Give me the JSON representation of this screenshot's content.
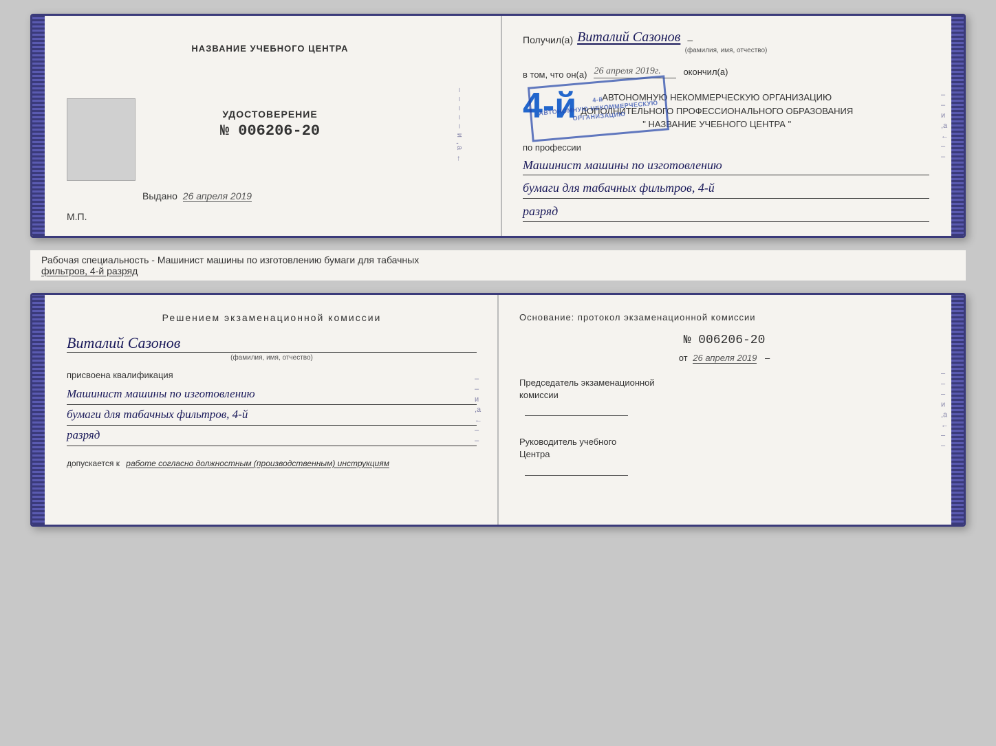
{
  "topBook": {
    "leftPage": {
      "centerTitle": "НАЗВАНИЕ УЧЕБНОГО ЦЕНТРА",
      "certLabel": "УДОСТОВЕРЕНИЕ",
      "certNumber": "№ 006206-20",
      "issuedLabel": "Выдано",
      "issuedDate": "26 апреля 2019",
      "mpLabel": "М.П."
    },
    "rightPage": {
      "recipientPrefix": "Получил(а)",
      "recipientName": "Виталий Сазонов",
      "recipientSubLabel": "(фамилия, имя, отчество)",
      "vtomLabel": "в том, что он(а)",
      "vtomDate": "26 апреля 2019г.",
      "okonchilLabel": "окончил(а)",
      "orgLine1": "АВТОНОМНУЮ НЕКОММЕРЧЕСКУЮ ОРГАНИЗАЦИЮ",
      "orgLine2": "ДОПОЛНИТЕЛЬНОГО ПРОФЕССИОНАЛЬНОГО ОБРАЗОВАНИЯ",
      "orgLine3": "\" НАЗВАНИЕ УЧЕБНОГО ЦЕНТРА \"",
      "professionLabel": "по профессии",
      "professionLine1": "Машинист машины по изготовлению",
      "professionLine2": "бумаги для табачных фильтров, 4-й",
      "professionLine3": "разряд",
      "stampText": "4-й\nАВТОНОМНУЮ НЕКОММЕРЧЕСКУЮ\nОРГАНИЗАЦИЮ"
    }
  },
  "subtitleBar": {
    "text": "Рабочая специальность - Машинист машины по изготовлению бумаги для табачных",
    "textUnderlined": "фильтров, 4-й разряд"
  },
  "bottomBook": {
    "leftPage": {
      "decisionTitle": "Решением  экзаменационной  комиссии",
      "personName": "Виталий Сазонов",
      "personSubLabel": "(фамилия, имя, отчество)",
      "assignedLabel": "присвоена квалификация",
      "qualLine1": "Машинист машины по изготовлению",
      "qualLine2": "бумаги для табачных фильтров, 4-й",
      "qualLine3": "разряд",
      "allowedPrefix": "допускается к",
      "allowedText": "работе согласно должностным (производственным) инструкциям"
    },
    "rightPage": {
      "basisTitle": "Основание:  протокол  экзаменационной  комиссии",
      "protocolNumber": "№  006206-20",
      "datePrefix": "от",
      "dateValue": "26 апреля 2019",
      "chairLabel": "Председатель экзаменационной",
      "chairLabel2": "комиссии",
      "headLabel": "Руководитель учебного",
      "headLabel2": "Центра"
    }
  }
}
